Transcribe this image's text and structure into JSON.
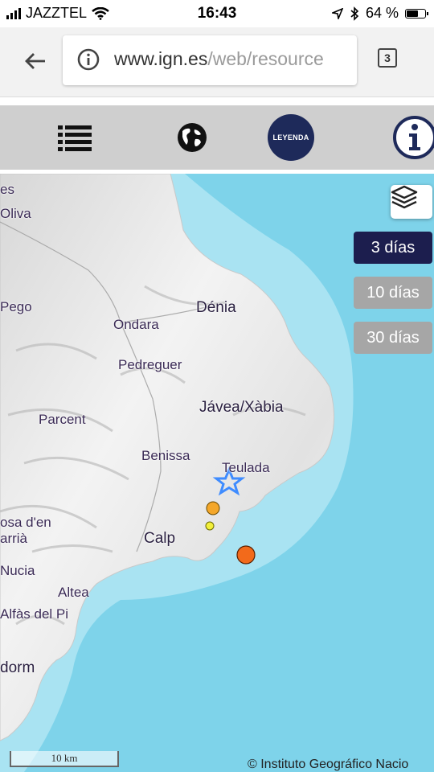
{
  "status": {
    "carrier": "JAZZTEL",
    "time": "16:43",
    "battery": "64 %",
    "battery_level": 0.64
  },
  "browser": {
    "url_domain": "www.ign.es",
    "url_path": "/web/resource",
    "tab_count": "3"
  },
  "toolbar": {
    "items": [
      "list-icon",
      "globe-icon",
      "legend-badge",
      "info-icon"
    ],
    "legend_label": "LEYENDA"
  },
  "map": {
    "places": [
      "es",
      "Oliva",
      "Pego",
      "Ondara",
      "Dénia",
      "Pedreguer",
      "Parcent",
      "Jávea/Xàbia",
      "Benissa",
      "Teulada",
      "osa d'en",
      "arrià",
      "Calp",
      "Nucia",
      "Altea",
      "Alfàs del Pi",
      "dorm"
    ],
    "period_buttons": [
      "3 días",
      "10 días",
      "30 días"
    ],
    "active_period": "3 días",
    "scale": "10 km",
    "attribution": "© Instituto Geográfico Nacio",
    "markers": [
      {
        "type": "star",
        "color": "#3f8cff"
      },
      {
        "type": "circle",
        "color": "#f4a72a"
      },
      {
        "type": "circle",
        "color": "#f2ef3a"
      },
      {
        "type": "circle",
        "color": "#f26a1b"
      }
    ],
    "colors": {
      "sea": "#7ed3ea",
      "shelf": "#a7e2f1",
      "land": "#eeeeee",
      "active_button": "#1c1e4e",
      "inactive_button": "#a6a6a6"
    }
  }
}
